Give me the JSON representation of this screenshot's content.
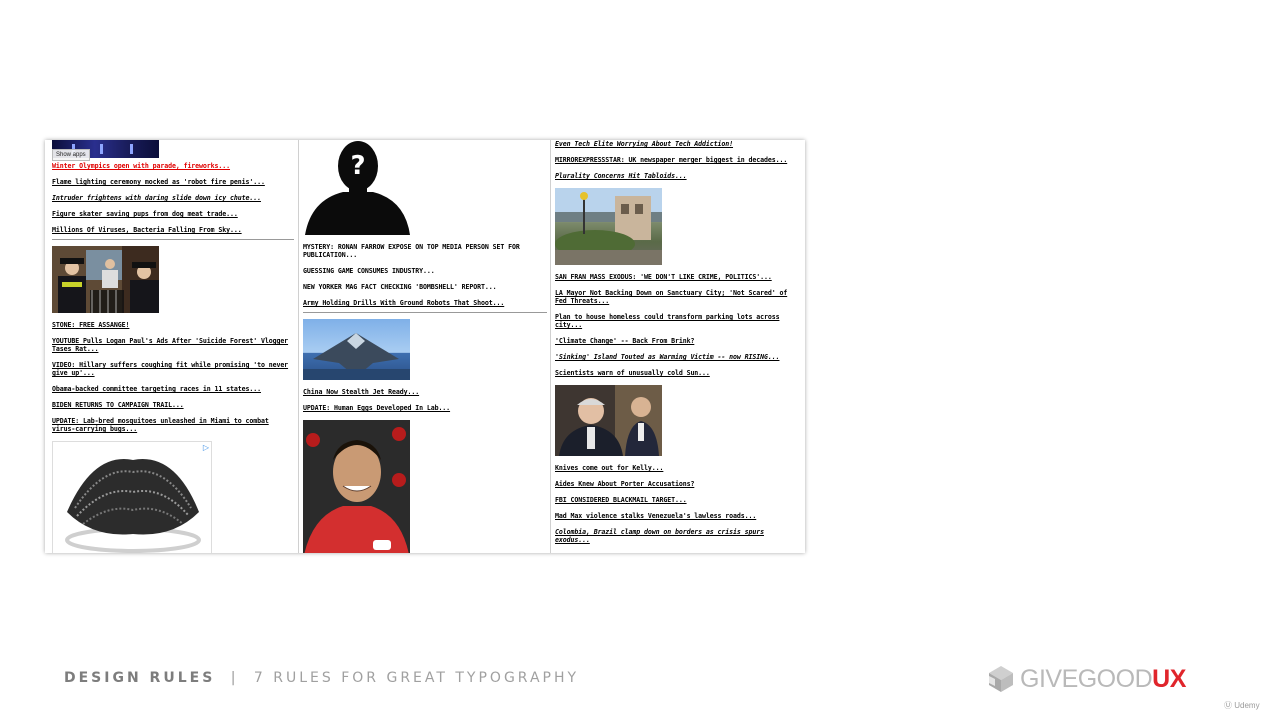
{
  "overlay": {
    "show_apps": "Show apps"
  },
  "col1": {
    "headlines_top": [
      {
        "text": "Winter Olympics open with parade, fireworks...",
        "style": "red"
      },
      {
        "text": "Flame lighting ceremony mocked as 'robot fire penis'...",
        "style": "normal"
      },
      {
        "text": "Intruder frightens with daring slide down icy chute...",
        "style": "italic"
      },
      {
        "text": "Figure skater saving pups from dog meat trade...",
        "style": "normal"
      },
      {
        "text": "Millions Of Viruses, Bacteria Falling From Sky...",
        "style": "normal"
      }
    ],
    "headlines_bottom": [
      {
        "text": "STONE: FREE ASSANGE!",
        "style": "normal"
      },
      {
        "text": "YOUTUBE Pulls Logan Paul's Ads After 'Suicide Forest' Vlogger Tases Rat...",
        "style": "normal"
      },
      {
        "text": "VIDEO: Hillary suffers coughing fit while promising 'to never give up'...",
        "style": "normal"
      },
      {
        "text": "Obama-backed committee targeting races in 11 states...",
        "style": "normal"
      },
      {
        "text": "BIDEN RETURNS TO CAMPAIGN TRAIL...",
        "style": "normal"
      },
      {
        "text": "UPDATE: Lab-bred mosquitoes unleashed in Miami to combat virus-carrying bugs...",
        "style": "normal"
      }
    ]
  },
  "col2": {
    "headlines_a": [
      {
        "text": "MYSTERY: RONAN FARROW EXPOSE ON TOP MEDIA PERSON SET FOR PUBLICATION...",
        "style": "plain"
      },
      {
        "text": "GUESSING GAME CONSUMES INDUSTRY...",
        "style": "plain"
      },
      {
        "text": "NEW YORKER MAG FACT CHECKING 'BOMBSHELL' REPORT...",
        "style": "plain"
      },
      {
        "text": "Army Holding Drills With Ground Robots That Shoot...",
        "style": "normal"
      }
    ],
    "headlines_b": [
      {
        "text": "China Now Stealth Jet Ready...",
        "style": "normal"
      },
      {
        "text": "UPDATE: Human Eggs Developed In Lab...",
        "style": "normal"
      }
    ]
  },
  "col3": {
    "headlines_a": [
      {
        "text": "Even Tech Elite Worrying About Tech Addiction!",
        "style": "italic"
      },
      {
        "text": "MIRROREXPRESSSTAR: UK newspaper merger biggest in decades...",
        "style": "normal"
      },
      {
        "text": "Plurality Concerns Hit Tabloids...",
        "style": "italic"
      }
    ],
    "headlines_b": [
      {
        "text": "SAN FRAN MASS EXODUS: 'WE DON'T LIKE CRIME, POLITICS'...",
        "style": "normal"
      },
      {
        "text": "LA Mayor Not Backing Down on Sanctuary City; 'Not Scared' of Fed Threats...",
        "style": "normal"
      },
      {
        "text": "Plan to house homeless could transform parking lots across city...",
        "style": "normal"
      },
      {
        "text": "'Climate Change' -- Back From Brink?",
        "style": "normal"
      },
      {
        "text": "'Sinking' Island Touted as Warming Victim -- now RISING...",
        "style": "italic"
      },
      {
        "text": "Scientists warn of unusually cold Sun...",
        "style": "normal"
      }
    ],
    "headlines_c": [
      {
        "text": "Knives come out for Kelly...",
        "style": "normal"
      },
      {
        "text": "Aides Knew About Porter Accusations?",
        "style": "normal"
      },
      {
        "text": "FBI CONSIDERED BLACKMAIL TARGET...",
        "style": "normal"
      },
      {
        "text": "Mad Max violence stalks Venezuela's lawless roads...",
        "style": "normal"
      },
      {
        "text": "Colombia, Brazil clamp down on borders as crisis spurs exodus...",
        "style": "italic"
      }
    ]
  },
  "footer": {
    "course_strong": "DESIGN RULES",
    "divider": "|",
    "course_title": "7 RULES FOR GREAT TYPOGRAPHY",
    "brand_word": "GIVEGOOD",
    "brand_ux": "UX",
    "udemy": "Udemy"
  },
  "colors": {
    "brand_red": "#e0252b",
    "link_red": "#e00000",
    "footer_gray": "#8a8a8a"
  }
}
